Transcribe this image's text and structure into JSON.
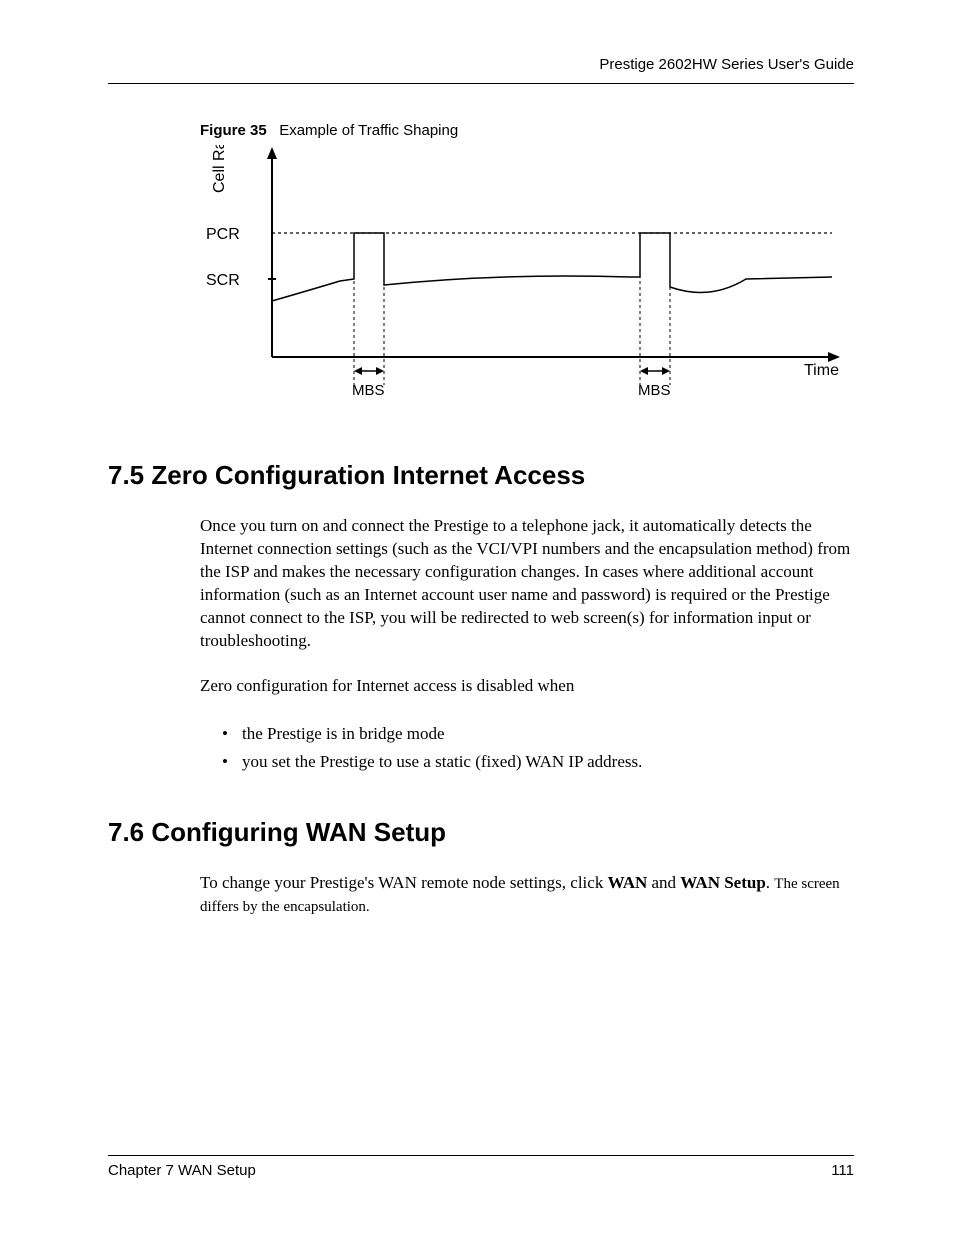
{
  "header": {
    "guide_title": "Prestige 2602HW Series User's Guide"
  },
  "figure": {
    "label": "Figure 35",
    "caption": "Example of Traffic Shaping",
    "labels": {
      "y_axis": "Cell Rate",
      "x_axis": "Time",
      "pcr": "PCR",
      "scr": "SCR",
      "mbs1": "MBS",
      "mbs2": "MBS"
    }
  },
  "section75": {
    "heading": "7.5  Zero Configuration Internet Access",
    "para1": "Once you turn on and connect the Prestige to a telephone jack, it automatically detects the Internet connection settings (such as the VCI/VPI numbers and the encapsulation method) from the ISP and makes the necessary configuration changes. In cases where additional account information (such as an Internet account user name and password) is required or the Prestige cannot connect to the ISP, you will be redirected to web screen(s) for information input or troubleshooting.",
    "para2": "Zero configuration for Internet access is disabled when",
    "bullet1": "the Prestige is in bridge mode",
    "bullet2": "you set the Prestige to use a static (fixed) WAN IP address."
  },
  "section76": {
    "heading": "7.6  Configuring WAN Setup",
    "para_pre": "To change your Prestige's WAN remote node settings, click ",
    "para_b1": "WAN",
    "para_mid": " and ",
    "para_b2": "WAN Setup",
    "para_post": ". ",
    "para_tail": "The screen differs by the encapsulation."
  },
  "footer": {
    "left": "Chapter 7 WAN Setup",
    "right": "111"
  },
  "chart_data": {
    "type": "line",
    "title": "Example of Traffic Shaping",
    "xlabel": "Time",
    "ylabel": "Cell Rate",
    "y_reference_lines": [
      {
        "name": "PCR",
        "value": 1.0,
        "style": "dashed"
      },
      {
        "name": "SCR",
        "value": 0.65
      }
    ],
    "x": [
      0,
      0.12,
      0.16,
      0.16,
      0.2,
      0.2,
      0.5,
      0.6,
      0.6,
      0.64,
      0.64,
      0.74,
      0.85,
      1.0
    ],
    "y": [
      0.58,
      0.65,
      0.65,
      1.0,
      1.0,
      0.62,
      0.66,
      0.66,
      1.0,
      1.0,
      0.6,
      0.58,
      0.66,
      0.66
    ],
    "annotations": [
      {
        "text": "MBS",
        "x_range": [
          0.16,
          0.2
        ]
      },
      {
        "text": "MBS",
        "x_range": [
          0.6,
          0.64
        ]
      }
    ],
    "xlim": [
      0,
      1
    ],
    "ylim": [
      0,
      1.15
    ]
  }
}
